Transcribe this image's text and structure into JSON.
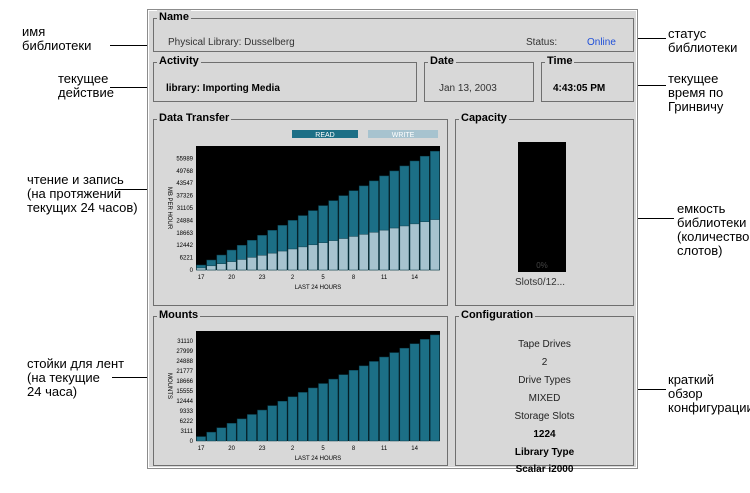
{
  "annotations": {
    "library_name": [
      "имя",
      "библиотеки"
    ],
    "current_action": [
      "текущее",
      "действие"
    ],
    "read_write": [
      "чтение и запись",
      "(на протяжении",
      "текущих 24 часов)"
    ],
    "mounts": [
      "стойки для лент",
      "(на текущие",
      "24 часа)"
    ],
    "library_status": [
      "статус",
      "библиотеки"
    ],
    "gmt_time": [
      "текущее",
      "время по",
      "Гринвичу"
    ],
    "capacity": [
      "емкость",
      "библиотеки",
      "(количество",
      "слотов)"
    ],
    "config_summary": [
      "краткий",
      "обзор",
      "конфигурации"
    ]
  },
  "name_group": {
    "title": "Name",
    "library_text": "Physical Library: Dusselberg",
    "status_label": "Status:",
    "status_value": "Online"
  },
  "activity_group": {
    "title": "Activity",
    "text": "library: Importing Media"
  },
  "date_group": {
    "title": "Date",
    "text": "Jan 13, 2003"
  },
  "time_group": {
    "title": "Time",
    "text": "4:43:05 PM"
  },
  "data_transfer": {
    "title": "Data Transfer",
    "legend_read": "READ",
    "legend_write": "WRITE",
    "colors": {
      "read": "#1c6f86",
      "write": "#a7c3cf",
      "plot_bg": "#000000"
    }
  },
  "capacity_group": {
    "title": "Capacity",
    "percent": "0%",
    "slots_text": "Slots0/12...",
    "fill_fraction": 0.0
  },
  "mounts_group": {
    "title": "Mounts",
    "colors": {
      "bar": "#1c6f86",
      "plot_bg": "#000000"
    }
  },
  "configuration": {
    "title": "Configuration",
    "tape_drives_label": "Tape Drives",
    "tape_drives_value": "2",
    "drive_types_label": "Drive Types",
    "drive_types_value": "MIXED",
    "storage_slots_label": "Storage Slots",
    "storage_slots_value": "1224",
    "library_type_label": "Library Type",
    "library_type_value": "Scalar i2000"
  },
  "chart_data": [
    {
      "type": "bar",
      "title": "Data Transfer",
      "xlabel": "LAST 24 HOURS",
      "ylabel": "MB PER HOUR",
      "x_tick_labels": [
        "17",
        "20",
        "23",
        "2",
        "5",
        "8",
        "11",
        "14"
      ],
      "y_tick_labels": [
        "0",
        "6221",
        "12442",
        "18663",
        "24884",
        "31105",
        "37326",
        "43547",
        "49768",
        "55989"
      ],
      "ylim": [
        0,
        62210
      ],
      "series": [
        {
          "name": "READ",
          "values": [
            2500,
            5000,
            7500,
            10000,
            12400,
            14900,
            17400,
            19900,
            22400,
            24900,
            27300,
            29800,
            32300,
            34800,
            37300,
            39800,
            42200,
            44700,
            47200,
            49700,
            52200,
            54700,
            57100,
            59600
          ]
        },
        {
          "name": "WRITE",
          "values": [
            1050,
            2100,
            3150,
            4200,
            5300,
            6350,
            7400,
            8450,
            9500,
            10550,
            11600,
            12650,
            13700,
            14750,
            15800,
            16850,
            17900,
            18950,
            20000,
            21050,
            22100,
            23150,
            24200,
            25300
          ]
        }
      ],
      "legend": "top"
    },
    {
      "type": "bar",
      "title": "Mounts",
      "xlabel": "LAST 24 HOURS",
      "ylabel": "MOUNTS",
      "x_tick_labels": [
        "17",
        "20",
        "23",
        "2",
        "5",
        "8",
        "11",
        "14"
      ],
      "y_tick_labels": [
        "0",
        "3111",
        "6222",
        "9333",
        "12444",
        "15555",
        "18666",
        "21777",
        "24888",
        "27999",
        "31110"
      ],
      "ylim": [
        0,
        31110
      ],
      "series": [
        {
          "name": "",
          "values": [
            1250,
            2500,
            3750,
            5000,
            6250,
            7500,
            8750,
            10000,
            11250,
            12500,
            13750,
            15000,
            16250,
            17500,
            18750,
            20000,
            21250,
            22500,
            23750,
            25000,
            26250,
            27500,
            28750,
            30000
          ]
        }
      ]
    }
  ]
}
